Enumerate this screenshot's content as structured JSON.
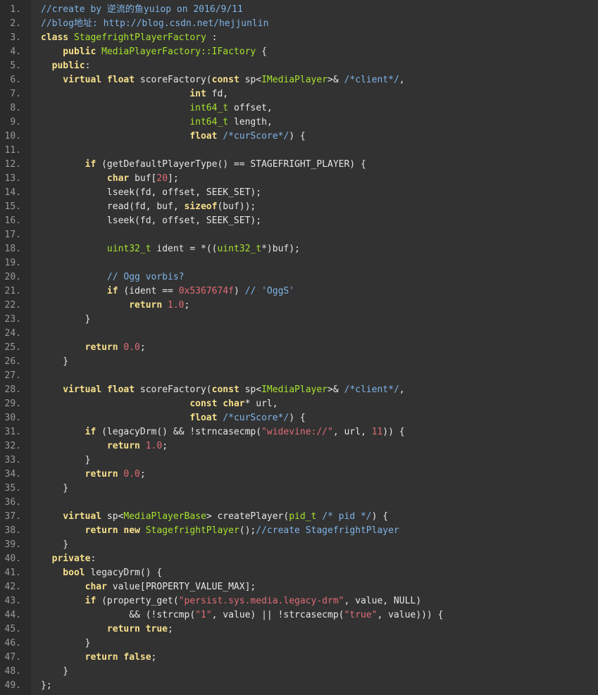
{
  "colors": {
    "background": "#323232",
    "gutter": "#2b2b2b",
    "line_number": "#9a9a9a",
    "plain": "#e6e6e6",
    "keyword": "#f7e08c",
    "type": "#a6e22e",
    "comment": "#7fb3e6",
    "string": "#e06c75",
    "number": "#e06c75"
  },
  "lines": [
    {
      "n": "1.",
      "tokens": [
        {
          "t": "//create by 逆流的鱼yuiop on 2016/9/11",
          "c": "cm"
        }
      ]
    },
    {
      "n": "2.",
      "tokens": [
        {
          "t": "//blog地址: http://blog.csdn.net/hejjunlin",
          "c": "cm"
        }
      ]
    },
    {
      "n": "3.",
      "tokens": [
        {
          "t": "class ",
          "c": "kw"
        },
        {
          "t": "StagefrightPlayerFactory",
          "c": "ty"
        },
        {
          "t": " :",
          "c": "pl"
        }
      ]
    },
    {
      "n": "4.",
      "tokens": [
        {
          "t": "    public ",
          "c": "kw"
        },
        {
          "t": "MediaPlayerFactory::IFactory",
          "c": "ty"
        },
        {
          "t": " {",
          "c": "pl"
        }
      ]
    },
    {
      "n": "5.",
      "tokens": [
        {
          "t": "  public",
          "c": "kw"
        },
        {
          "t": ":",
          "c": "pl"
        }
      ]
    },
    {
      "n": "6.",
      "tokens": [
        {
          "t": "    virtual float ",
          "c": "kw"
        },
        {
          "t": "scoreFactory(",
          "c": "pl"
        },
        {
          "t": "const ",
          "c": "kw"
        },
        {
          "t": "sp<",
          "c": "pl"
        },
        {
          "t": "IMediaPlayer",
          "c": "ty"
        },
        {
          "t": ">& ",
          "c": "pl"
        },
        {
          "t": "/*client*/",
          "c": "cm"
        },
        {
          "t": ",",
          "c": "pl"
        }
      ]
    },
    {
      "n": "7.",
      "tokens": [
        {
          "t": "                           ",
          "c": "pl"
        },
        {
          "t": "int ",
          "c": "kw"
        },
        {
          "t": "fd,",
          "c": "pl"
        }
      ]
    },
    {
      "n": "8.",
      "tokens": [
        {
          "t": "                           ",
          "c": "pl"
        },
        {
          "t": "int64_t ",
          "c": "ty"
        },
        {
          "t": "offset,",
          "c": "pl"
        }
      ]
    },
    {
      "n": "9.",
      "tokens": [
        {
          "t": "                           ",
          "c": "pl"
        },
        {
          "t": "int64_t ",
          "c": "ty"
        },
        {
          "t": "length,",
          "c": "pl"
        }
      ]
    },
    {
      "n": "10.",
      "tokens": [
        {
          "t": "                           ",
          "c": "pl"
        },
        {
          "t": "float ",
          "c": "kw"
        },
        {
          "t": "/*curScore*/",
          "c": "cm"
        },
        {
          "t": ") {",
          "c": "pl"
        }
      ]
    },
    {
      "n": "11.",
      "tokens": []
    },
    {
      "n": "12.",
      "tokens": [
        {
          "t": "        if ",
          "c": "kw"
        },
        {
          "t": "(getDefaultPlayerType() == STAGEFRIGHT_PLAYER) {",
          "c": "pl"
        }
      ]
    },
    {
      "n": "13.",
      "tokens": [
        {
          "t": "            char ",
          "c": "kw"
        },
        {
          "t": "buf[",
          "c": "pl"
        },
        {
          "t": "20",
          "c": "nu"
        },
        {
          "t": "];",
          "c": "pl"
        }
      ]
    },
    {
      "n": "14.",
      "tokens": [
        {
          "t": "            lseek(fd, offset, SEEK_SET);",
          "c": "pl"
        }
      ]
    },
    {
      "n": "15.",
      "tokens": [
        {
          "t": "            read(fd, buf, ",
          "c": "pl"
        },
        {
          "t": "sizeof",
          "c": "kw"
        },
        {
          "t": "(buf));",
          "c": "pl"
        }
      ]
    },
    {
      "n": "16.",
      "tokens": [
        {
          "t": "            lseek(fd, offset, SEEK_SET);",
          "c": "pl"
        }
      ]
    },
    {
      "n": "17.",
      "tokens": []
    },
    {
      "n": "18.",
      "tokens": [
        {
          "t": "            ",
          "c": "pl"
        },
        {
          "t": "uint32_t ",
          "c": "ty"
        },
        {
          "t": "ident = *((",
          "c": "pl"
        },
        {
          "t": "uint32_t",
          "c": "ty"
        },
        {
          "t": "*)buf);",
          "c": "pl"
        }
      ]
    },
    {
      "n": "19.",
      "tokens": []
    },
    {
      "n": "20.",
      "tokens": [
        {
          "t": "            // Ogg vorbis?",
          "c": "cm"
        }
      ]
    },
    {
      "n": "21.",
      "tokens": [
        {
          "t": "            if ",
          "c": "kw"
        },
        {
          "t": "(ident == ",
          "c": "pl"
        },
        {
          "t": "0x5367674f",
          "c": "nu"
        },
        {
          "t": ") ",
          "c": "pl"
        },
        {
          "t": "// 'OggS'",
          "c": "cm"
        }
      ]
    },
    {
      "n": "22.",
      "tokens": [
        {
          "t": "                return ",
          "c": "kw"
        },
        {
          "t": "1.0",
          "c": "nu"
        },
        {
          "t": ";",
          "c": "pl"
        }
      ]
    },
    {
      "n": "23.",
      "tokens": [
        {
          "t": "        }",
          "c": "pl"
        }
      ]
    },
    {
      "n": "24.",
      "tokens": []
    },
    {
      "n": "25.",
      "tokens": [
        {
          "t": "        return ",
          "c": "kw"
        },
        {
          "t": "0.0",
          "c": "nu"
        },
        {
          "t": ";",
          "c": "pl"
        }
      ]
    },
    {
      "n": "26.",
      "tokens": [
        {
          "t": "    }",
          "c": "pl"
        }
      ]
    },
    {
      "n": "27.",
      "tokens": []
    },
    {
      "n": "28.",
      "tokens": [
        {
          "t": "    virtual float ",
          "c": "kw"
        },
        {
          "t": "scoreFactory(",
          "c": "pl"
        },
        {
          "t": "const ",
          "c": "kw"
        },
        {
          "t": "sp<",
          "c": "pl"
        },
        {
          "t": "IMediaPlayer",
          "c": "ty"
        },
        {
          "t": ">& ",
          "c": "pl"
        },
        {
          "t": "/*client*/",
          "c": "cm"
        },
        {
          "t": ",",
          "c": "pl"
        }
      ]
    },
    {
      "n": "29.",
      "tokens": [
        {
          "t": "                           ",
          "c": "pl"
        },
        {
          "t": "const char",
          "c": "kw"
        },
        {
          "t": "* url,",
          "c": "pl"
        }
      ]
    },
    {
      "n": "30.",
      "tokens": [
        {
          "t": "                           ",
          "c": "pl"
        },
        {
          "t": "float ",
          "c": "kw"
        },
        {
          "t": "/*curScore*/",
          "c": "cm"
        },
        {
          "t": ") {",
          "c": "pl"
        }
      ]
    },
    {
      "n": "31.",
      "tokens": [
        {
          "t": "        if ",
          "c": "kw"
        },
        {
          "t": "(legacyDrm() && !strncasecmp(",
          "c": "pl"
        },
        {
          "t": "\"widevine://\"",
          "c": "st"
        },
        {
          "t": ", url, ",
          "c": "pl"
        },
        {
          "t": "11",
          "c": "nu"
        },
        {
          "t": ")) {",
          "c": "pl"
        }
      ]
    },
    {
      "n": "32.",
      "tokens": [
        {
          "t": "            return ",
          "c": "kw"
        },
        {
          "t": "1.0",
          "c": "nu"
        },
        {
          "t": ";",
          "c": "pl"
        }
      ]
    },
    {
      "n": "33.",
      "tokens": [
        {
          "t": "        }",
          "c": "pl"
        }
      ]
    },
    {
      "n": "34.",
      "tokens": [
        {
          "t": "        return ",
          "c": "kw"
        },
        {
          "t": "0.0",
          "c": "nu"
        },
        {
          "t": ";",
          "c": "pl"
        }
      ]
    },
    {
      "n": "35.",
      "tokens": [
        {
          "t": "    }",
          "c": "pl"
        }
      ]
    },
    {
      "n": "36.",
      "tokens": []
    },
    {
      "n": "37.",
      "tokens": [
        {
          "t": "    virtual ",
          "c": "kw"
        },
        {
          "t": "sp<",
          "c": "pl"
        },
        {
          "t": "MediaPlayerBase",
          "c": "ty"
        },
        {
          "t": "> createPlayer(",
          "c": "pl"
        },
        {
          "t": "pid_t ",
          "c": "ty"
        },
        {
          "t": "/* pid */",
          "c": "cm"
        },
        {
          "t": ") {",
          "c": "pl"
        }
      ]
    },
    {
      "n": "38.",
      "tokens": [
        {
          "t": "        return new ",
          "c": "kw"
        },
        {
          "t": "StagefrightPlayer",
          "c": "ty"
        },
        {
          "t": "();",
          "c": "pl"
        },
        {
          "t": "//create StagefrightPlayer",
          "c": "cm"
        }
      ]
    },
    {
      "n": "39.",
      "tokens": [
        {
          "t": "    }",
          "c": "pl"
        }
      ]
    },
    {
      "n": "40.",
      "tokens": [
        {
          "t": "  private",
          "c": "kw"
        },
        {
          "t": ":",
          "c": "pl"
        }
      ]
    },
    {
      "n": "41.",
      "tokens": [
        {
          "t": "    bool ",
          "c": "kw"
        },
        {
          "t": "legacyDrm() {",
          "c": "pl"
        }
      ]
    },
    {
      "n": "42.",
      "tokens": [
        {
          "t": "        char ",
          "c": "kw"
        },
        {
          "t": "value[PROPERTY_VALUE_MAX];",
          "c": "pl"
        }
      ]
    },
    {
      "n": "43.",
      "tokens": [
        {
          "t": "        if ",
          "c": "kw"
        },
        {
          "t": "(property_get(",
          "c": "pl"
        },
        {
          "t": "\"persist.sys.media.legacy-drm\"",
          "c": "st"
        },
        {
          "t": ", value, NULL)",
          "c": "pl"
        }
      ]
    },
    {
      "n": "44.",
      "tokens": [
        {
          "t": "                && (!strcmp(",
          "c": "pl"
        },
        {
          "t": "\"1\"",
          "c": "st"
        },
        {
          "t": ", value) || !strcasecmp(",
          "c": "pl"
        },
        {
          "t": "\"true\"",
          "c": "st"
        },
        {
          "t": ", value))) {",
          "c": "pl"
        }
      ]
    },
    {
      "n": "45.",
      "tokens": [
        {
          "t": "            return true",
          "c": "kw"
        },
        {
          "t": ";",
          "c": "pl"
        }
      ]
    },
    {
      "n": "46.",
      "tokens": [
        {
          "t": "        }",
          "c": "pl"
        }
      ]
    },
    {
      "n": "47.",
      "tokens": [
        {
          "t": "        return false",
          "c": "kw"
        },
        {
          "t": ";",
          "c": "pl"
        }
      ]
    },
    {
      "n": "48.",
      "tokens": [
        {
          "t": "    }",
          "c": "pl"
        }
      ]
    },
    {
      "n": "49.",
      "tokens": [
        {
          "t": "};",
          "c": "pl"
        }
      ]
    }
  ]
}
